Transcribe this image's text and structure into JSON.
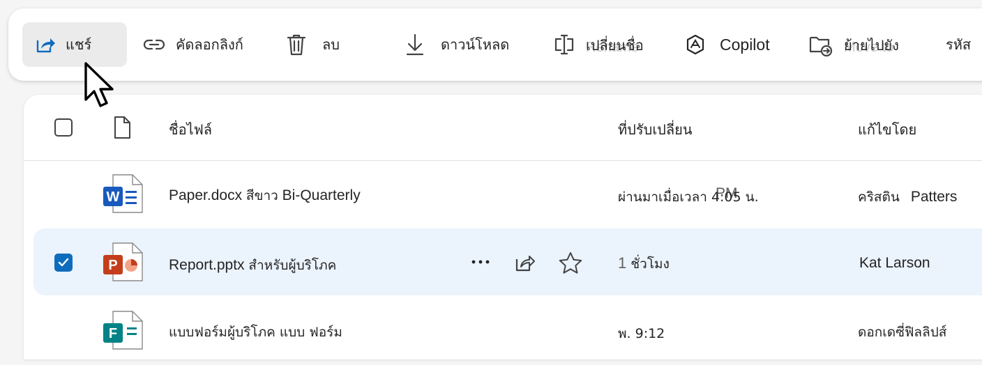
{
  "toolbar": {
    "share_label": "แชร์",
    "copy_link_label": "คัดลอกลิงก์",
    "delete_label": "ลบ",
    "download_label": "ดาวน์โหลด",
    "rename_label": "เปลี่ยนชื่อ",
    "rename_ghost": "Rename",
    "copilot_label": "Copilot",
    "move_label": "ย้ายไปยัง",
    "move_ghost": "Move to",
    "code_label": "รหัส"
  },
  "table": {
    "headers": {
      "name": "ชื่อไฟล์",
      "modified": "ที่ปรับเปลี่ยน",
      "modified_by": "แก้ไขโดย"
    },
    "rows": [
      {
        "name_en": "Paper.docx ",
        "name_th": "สีขาว",
        "name_en2": " Bi-Quarterly",
        "modified": "ผ่านมาเมื่อเวลา ",
        "modified_time": "4:05",
        "modified_overlap": "PM",
        "modified_suffix": "น.",
        "by_th": "คริสติน",
        "by_en": "Patters",
        "icon": "word-doc-icon",
        "selected": false
      },
      {
        "name_en": "Report.pptx ",
        "name_th": "สำหรับผู้บริโภค",
        "modified_num": "1",
        "modified_th": " ชั่วโมง",
        "by_en": "Kat Larson",
        "icon": "powerpoint-icon",
        "selected": true
      },
      {
        "name_th": "แบบฟอร์มผู้บริโภค แบบ ฟอร์ม",
        "modified": "พ. 9:12",
        "by_th": "ดอกเดซี่ฟิลลิปส์",
        "icon": "forms-icon",
        "selected": false
      }
    ]
  },
  "colors": {
    "accent": "#0f6cbd",
    "selected_row": "#ebf3fc",
    "word": "#185abd",
    "powerpoint": "#c43e1c",
    "forms": "#038387"
  }
}
